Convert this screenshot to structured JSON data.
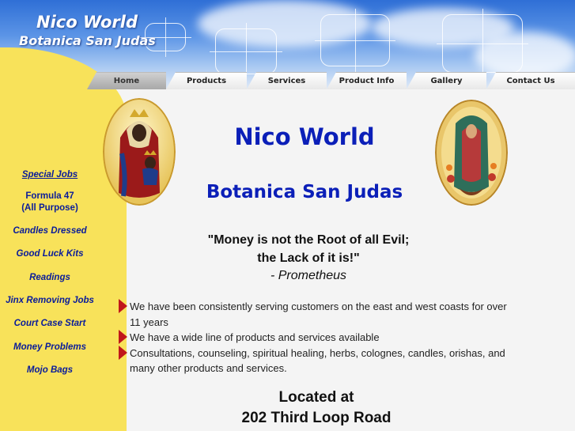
{
  "header": {
    "title": "Nico World",
    "subtitle": "Botanica San Judas"
  },
  "tabs": [
    {
      "label": "Home",
      "active": true
    },
    {
      "label": "Products",
      "active": false
    },
    {
      "label": "Services",
      "active": false
    },
    {
      "label": "Product Info",
      "active": false
    },
    {
      "label": "Gallery",
      "active": false
    },
    {
      "label": "Contact Us",
      "active": false
    }
  ],
  "sidebar": {
    "items": [
      {
        "label": "Special Jobs"
      },
      {
        "label": "Formula 47"
      },
      {
        "label": "(All Purpose)"
      },
      {
        "label": "Candles Dressed"
      },
      {
        "label": "Good Luck Kits"
      },
      {
        "label": "Readings"
      },
      {
        "label": "Jinx Removing Jobs"
      },
      {
        "label": "Court Case Start"
      },
      {
        "label": "Money Problems"
      },
      {
        "label": "Mojo Bags"
      }
    ]
  },
  "main": {
    "title": "Nico World",
    "subtitle": "Botanica San Judas",
    "quote_line1": "\"Money is not the Root of all Evil;",
    "quote_line2": "the Lack of it is!\"",
    "quote_author": "- Prometheus",
    "bullets": [
      "We have been consistently serving customers on the east and west coasts for over 11 years",
      "We have a wide line of products and services available",
      "Consultations, counseling, spiritual healing, herbs, colognes, candles, orishas, and many other products and services."
    ],
    "located_label": "Located at",
    "address": "202 Third Loop Road"
  },
  "images": {
    "left": "madonna-icon",
    "right": "guadalupe-icon"
  },
  "colors": {
    "accent": "#0b1fb8",
    "sidebar_bg": "#f8e25a",
    "bullet": "#c0161b",
    "link": "#0a1c9a"
  }
}
